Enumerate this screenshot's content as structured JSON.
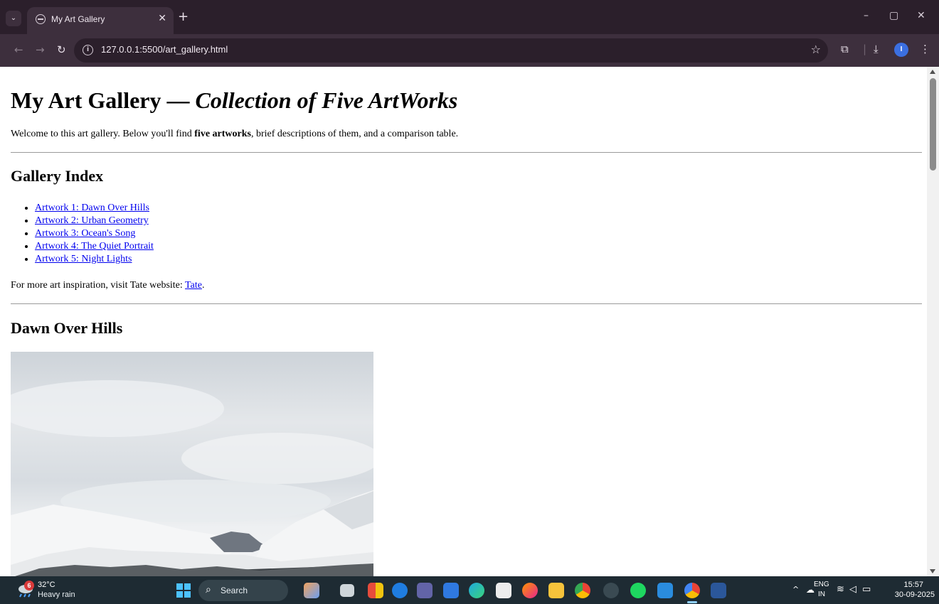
{
  "browser": {
    "tab_title": "My Art Gallery",
    "url": "127.0.0.1:5500/art_gallery.html",
    "icons": [
      "tab-search-icon",
      "globe-icon",
      "close-icon",
      "plus-icon",
      "minimize-icon",
      "restore-icon",
      "back-icon",
      "forward-icon",
      "reload-icon",
      "info-icon",
      "star-icon",
      "extensions-icon",
      "download-icon",
      "profile-icon",
      "more-icon"
    ],
    "profile_initial": "I"
  },
  "page": {
    "title_main": "My Art Gallery — ",
    "title_em": "Collection of Five ArtWorks",
    "intro_before": "Welcome to this art gallery. Below you'll find ",
    "intro_bold": "five artworks",
    "intro_after": ", brief descriptions of them, and a comparison table.",
    "index_heading": "Gallery Index",
    "index_items": [
      "Artwork 1: Dawn Over Hills",
      "Artwork 2: Urban Geometry",
      "Artwork 3: Ocean's Song",
      "Artwork 4: The Quiet Portrait",
      "Artwork 5: Night Lights"
    ],
    "more_before": "For more art inspiration, visit Tate website: ",
    "more_link": "Tate",
    "more_after": ".",
    "artwork1_heading": "Dawn Over Hills"
  },
  "taskbar": {
    "weather_badge": "6",
    "weather_temp": "32°C",
    "weather_desc": "Heavy rain",
    "search_label": "Search",
    "lang_line1": "ENG",
    "lang_line2": "IN",
    "time": "15:57",
    "date": "30-09-2025",
    "accent": "#4cc2ff"
  }
}
